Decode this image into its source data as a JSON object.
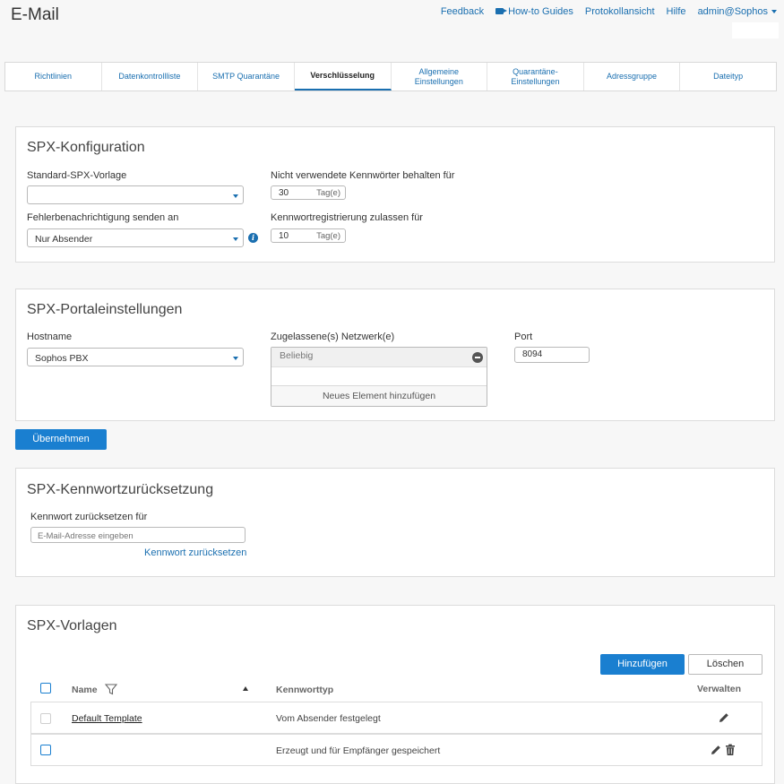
{
  "page": {
    "title": "E-Mail"
  },
  "top_links": {
    "feedback": "Feedback",
    "how_to": "How-to Guides",
    "log_view": "Protokollansicht",
    "help": "Hilfe",
    "user": "admin@Sophos"
  },
  "tabs": [
    {
      "label": "Richtlinien"
    },
    {
      "label": "Datenkontrollliste"
    },
    {
      "label": "SMTP Quarantäne"
    },
    {
      "label": "Verschlüsselung",
      "active": true
    },
    {
      "label": "Allgemeine\nEinstellungen"
    },
    {
      "label": "Quarantäne-\nEinstellungen"
    },
    {
      "label": "Adressgruppe"
    },
    {
      "label": "Dateityp"
    }
  ],
  "spx_config": {
    "title": "SPX-Konfiguration",
    "default_template_label": "Standard-SPX-Vorlage",
    "default_template_value": "",
    "error_notify_label": "Fehlerbenachrichtigung senden an",
    "error_notify_value": "Nur Absender",
    "keep_passwords_label": "Nicht verwendete Kennwörter behalten für",
    "keep_passwords_value": "30",
    "keep_passwords_unit": "Tag(e)",
    "allow_registration_label": "Kennwortregistrierung zulassen für",
    "allow_registration_value": "10",
    "allow_registration_unit": "Tag(e)"
  },
  "spx_portal": {
    "title": "SPX-Portaleinstellungen",
    "hostname_label": "Hostname",
    "hostname_value": "Sophos PBX",
    "networks_label": "Zugelassene(s) Netzwerk(e)",
    "networks": [
      "Beliebig"
    ],
    "add_item": "Neues Element hinzufügen",
    "port_label": "Port",
    "port_value": "8094"
  },
  "apply_button": "Übernehmen",
  "spx_reset": {
    "title": "SPX-Kennwortzurücksetzung",
    "label": "Kennwort zurücksetzen für",
    "placeholder": "E-Mail-Adresse eingeben",
    "link": "Kennwort zurücksetzen"
  },
  "spx_templates": {
    "title": "SPX-Vorlagen",
    "add_button": "Hinzufügen",
    "delete_button": "Löschen",
    "columns": {
      "name": "Name",
      "type": "Kennworttyp",
      "manage": "Verwalten"
    },
    "rows": [
      {
        "name": "Default Template",
        "type": "Vom Absender festgelegt"
      },
      {
        "name": "",
        "type": "Erzeugt und für Empfänger gespeichert"
      }
    ]
  },
  "colors": {
    "accent": "#1a7fd0",
    "link": "#1a6fb0"
  }
}
